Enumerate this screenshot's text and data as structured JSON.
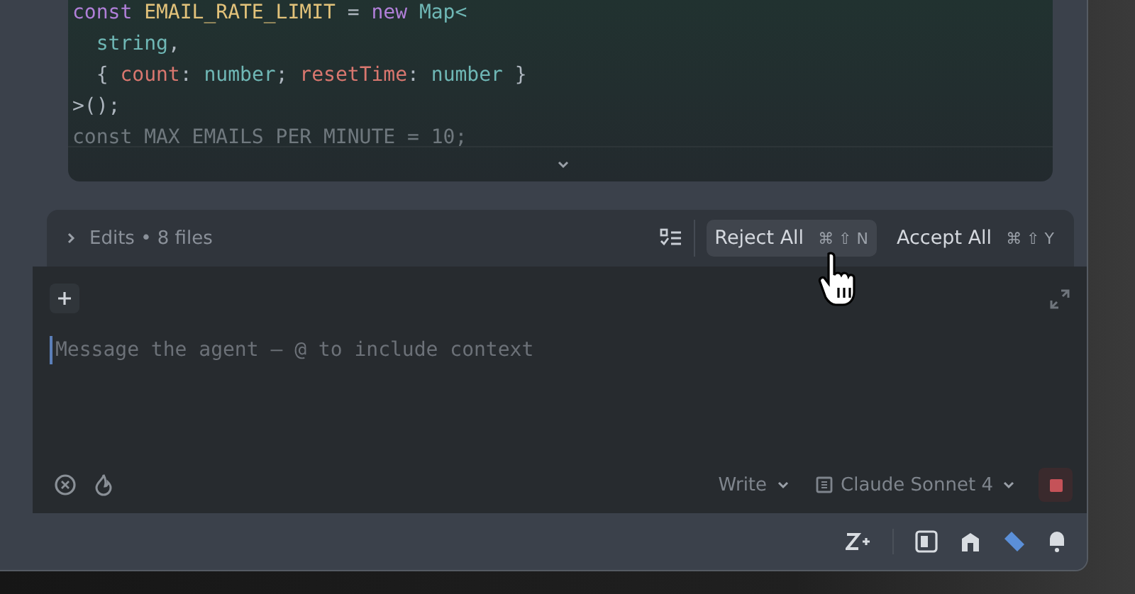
{
  "code_block": {
    "lines": [
      {
        "faded": false,
        "tokens": [
          {
            "text": "const ",
            "kind": "keyword"
          },
          {
            "text": "EMAIL_RATE_LIMIT",
            "kind": "constant"
          },
          {
            "text": " = ",
            "kind": "punct"
          },
          {
            "text": "new ",
            "kind": "keyword"
          },
          {
            "text": "Map<",
            "kind": "type"
          }
        ]
      },
      {
        "faded": false,
        "tokens": [
          {
            "text": "  string",
            "kind": "type"
          },
          {
            "text": ",",
            "kind": "punct"
          }
        ]
      },
      {
        "faded": false,
        "tokens": [
          {
            "text": "  { ",
            "kind": "punct"
          },
          {
            "text": "count",
            "kind": "property"
          },
          {
            "text": ": ",
            "kind": "punct"
          },
          {
            "text": "number",
            "kind": "type"
          },
          {
            "text": "; ",
            "kind": "punct"
          },
          {
            "text": "resetTime",
            "kind": "property"
          },
          {
            "text": ": ",
            "kind": "punct"
          },
          {
            "text": "number",
            "kind": "type"
          },
          {
            "text": " }",
            "kind": "punct"
          }
        ]
      },
      {
        "faded": false,
        "tokens": [
          {
            "text": ">();",
            "kind": "punct"
          }
        ]
      },
      {
        "faded": true,
        "tokens": [
          {
            "text": "const MAX_EMAILS_PER_MINUTE = 10;",
            "kind": "punct"
          }
        ]
      }
    ]
  },
  "edits_bar": {
    "expanded": false,
    "label": "Edits • 8 files",
    "reject_button": {
      "label": "Reject All",
      "shortcut": "⌘ ⇧ N",
      "hovered": true
    },
    "accept_button": {
      "label": "Accept All",
      "shortcut": "⌘ ⇧ Y",
      "hovered": false
    }
  },
  "composer": {
    "placeholder": "Message the agent — @ to include context",
    "mode": "Write",
    "model": "Claude Sonnet 4"
  }
}
